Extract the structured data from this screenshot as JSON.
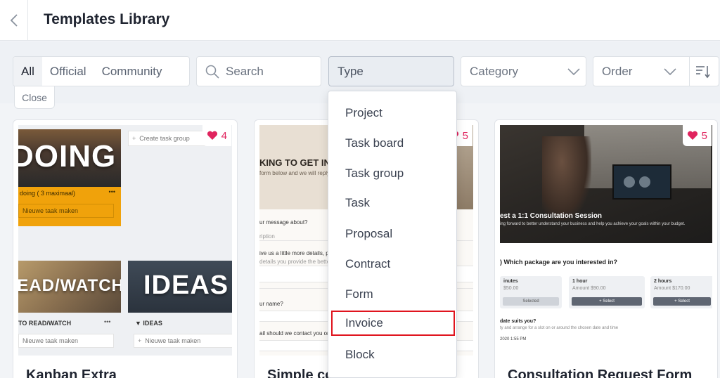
{
  "header": {
    "title": "Templates Library"
  },
  "filters": {
    "tabs": [
      "All",
      "Official",
      "Community"
    ],
    "close_label": "Close",
    "search_placeholder": "Search",
    "type_label": "Type",
    "category_label": "Category",
    "order_label": "Order"
  },
  "type_dropdown": {
    "options": [
      "Project",
      "Task board",
      "Task group",
      "Task",
      "Proposal",
      "Contract",
      "Form",
      "Invoice",
      "Block"
    ],
    "highlighted": "Invoice"
  },
  "cards": [
    {
      "title": "Kanban Extra",
      "likes": "4",
      "thumb": {
        "big1": "DOING",
        "sub1": "doing ( 3 maximaal)",
        "input1": "Nieuwe taak maken",
        "create": "Create task group",
        "big2": "READ/WATCH",
        "big3": "IDEAS",
        "col2": "TO READ/WATCH",
        "col3": "IDEAS",
        "input2": "Nieuwe taak maken",
        "input3": "Nieuwe taak maken"
      }
    },
    {
      "title": "Simple co",
      "likes": "5",
      "thumb": {
        "heading": "KING TO GET IN T",
        "sub": "form below and we will reply a",
        "q1": "ur message about?",
        "q1hint": "ription",
        "q2": "ive us a little more details, plea",
        "q2hint": "details you provide the better we c",
        "q3": "ur name?",
        "q4": "ail should we contact you on?"
      }
    },
    {
      "title": "Consultation Request Form",
      "likes": "5",
      "thumb": {
        "headline": "est a 1:1 Consultation Session",
        "subline": "ing forward to better understand your business and help you achieve your goals within your budget.",
        "question": ") Which package are you interested in?",
        "packages": [
          {
            "name": "inutes",
            "amount": "$50.00",
            "btn": "Selected"
          },
          {
            "name": "1 hour",
            "amount": "Amount $90.00",
            "btn": "+ Select"
          },
          {
            "name": "2 hours",
            "amount": "Amount $170.00",
            "btn": "+ Select"
          }
        ],
        "date_q": "date suits you?",
        "date_hint": "ty and arrange for a slot on or around the chosen date and time",
        "date_val": "2020 1:55 PM"
      }
    }
  ],
  "colors": {
    "accent_red": "#e0141e",
    "heart": "#e0245e",
    "kanban_orange": "#f0a20b"
  }
}
